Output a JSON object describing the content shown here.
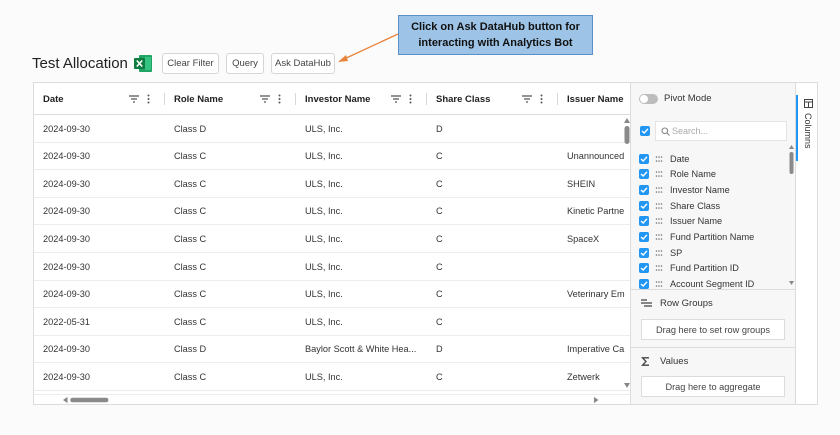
{
  "header": {
    "title": "Test Allocation",
    "excel_icon": "excel-icon",
    "buttons": {
      "clear_filter": "Clear Filter",
      "query": "Query",
      "ask_datahub": "Ask DataHub"
    }
  },
  "callout": {
    "line1": "Click on Ask DataHub button for",
    "line2": "interacting with Analytics Bot",
    "color": "#9dc3e6"
  },
  "grid": {
    "columns": [
      "Date",
      "Role Name",
      "Investor Name",
      "Share Class",
      "Issuer Name"
    ],
    "rows": [
      [
        "2024-09-30",
        "Class D",
        "ULS, Inc.",
        "D",
        ""
      ],
      [
        "2024-09-30",
        "Class C",
        "ULS, Inc.",
        "C",
        "Unannounced"
      ],
      [
        "2024-09-30",
        "Class C",
        "ULS, Inc.",
        "C",
        "SHEIN"
      ],
      [
        "2024-09-30",
        "Class C",
        "ULS, Inc.",
        "C",
        "Kinetic Partne"
      ],
      [
        "2024-09-30",
        "Class C",
        "ULS, Inc.",
        "C",
        "SpaceX"
      ],
      [
        "2024-09-30",
        "Class C",
        "ULS, Inc.",
        "C",
        ""
      ],
      [
        "2024-09-30",
        "Class C",
        "ULS, Inc.",
        "C",
        "Veterinary Em"
      ],
      [
        "2022-05-31",
        "Class C",
        "ULS, Inc.",
        "C",
        ""
      ],
      [
        "2024-09-30",
        "Class D",
        "Baylor Scott & White Hea...",
        "D",
        "Imperative Ca"
      ],
      [
        "2024-09-30",
        "Class C",
        "ULS, Inc.",
        "C",
        "Zetwerk"
      ]
    ]
  },
  "panel": {
    "pivot_mode": "Pivot Mode",
    "search_placeholder": "Search...",
    "columns": [
      "Date",
      "Role Name",
      "Investor Name",
      "Share Class",
      "Issuer Name",
      "Fund Partition Name",
      "SP",
      "Fund Partition ID",
      "Account Segment ID"
    ],
    "row_groups": {
      "title": "Row Groups",
      "drop": "Drag here to set row groups"
    },
    "values": {
      "title": "Values",
      "drop": "Drag here to aggregate"
    },
    "side_tab": "Columns"
  },
  "colors": {
    "accent": "#2196f3",
    "arrow": "#e8833a"
  }
}
